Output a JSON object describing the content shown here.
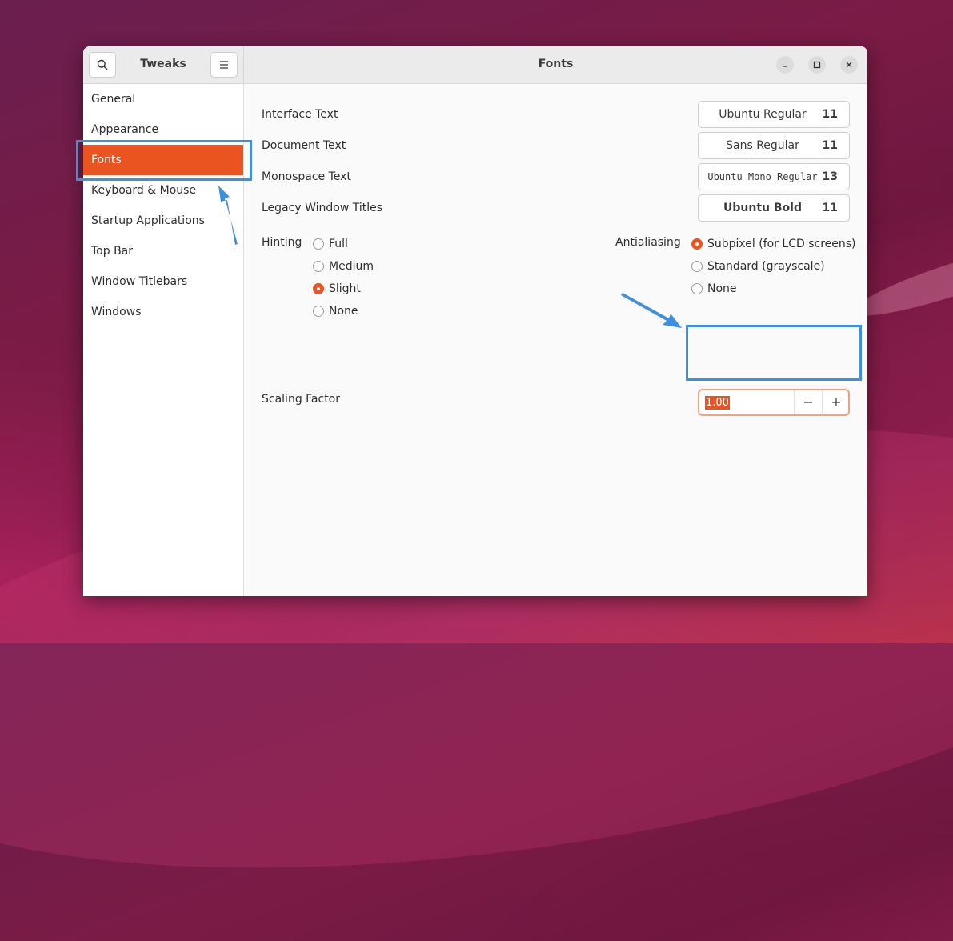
{
  "app": {
    "title": "Tweaks",
    "page_title": "Fonts"
  },
  "sidebar": {
    "items": [
      {
        "label": "General"
      },
      {
        "label": "Appearance"
      },
      {
        "label": "Fonts"
      },
      {
        "label": "Keyboard & Mouse"
      },
      {
        "label": "Startup Applications"
      },
      {
        "label": "Top Bar"
      },
      {
        "label": "Window Titlebars"
      },
      {
        "label": "Windows"
      }
    ],
    "selected": "Fonts"
  },
  "fonts": {
    "interface": {
      "label": "Interface Text",
      "font": "Ubuntu Regular",
      "size": "11"
    },
    "document": {
      "label": "Document Text",
      "font": "Sans Regular",
      "size": "11"
    },
    "monospace": {
      "label": "Monospace Text",
      "font": "Ubuntu Mono Regular",
      "size": "13"
    },
    "legacy": {
      "label": "Legacy Window Titles",
      "font": "Ubuntu Bold",
      "size": "11"
    }
  },
  "hinting": {
    "label": "Hinting",
    "options": [
      "Full",
      "Medium",
      "Slight",
      "None"
    ],
    "selected": "Slight"
  },
  "antialiasing": {
    "label": "Antialiasing",
    "options": [
      "Subpixel (for LCD screens)",
      "Standard (grayscale)",
      "None"
    ],
    "selected": "Subpixel (for LCD screens)"
  },
  "scaling": {
    "label": "Scaling Factor",
    "value": "1.00"
  },
  "colors": {
    "accent": "#e95420",
    "annotation": "#3d8fe0"
  },
  "icons": {
    "search": "search-icon",
    "menu": "hamburger-menu-icon",
    "minimize": "minimize-icon",
    "maximize": "maximize-icon",
    "close": "close-icon",
    "decrement": "minus-icon",
    "increment": "plus-icon"
  }
}
